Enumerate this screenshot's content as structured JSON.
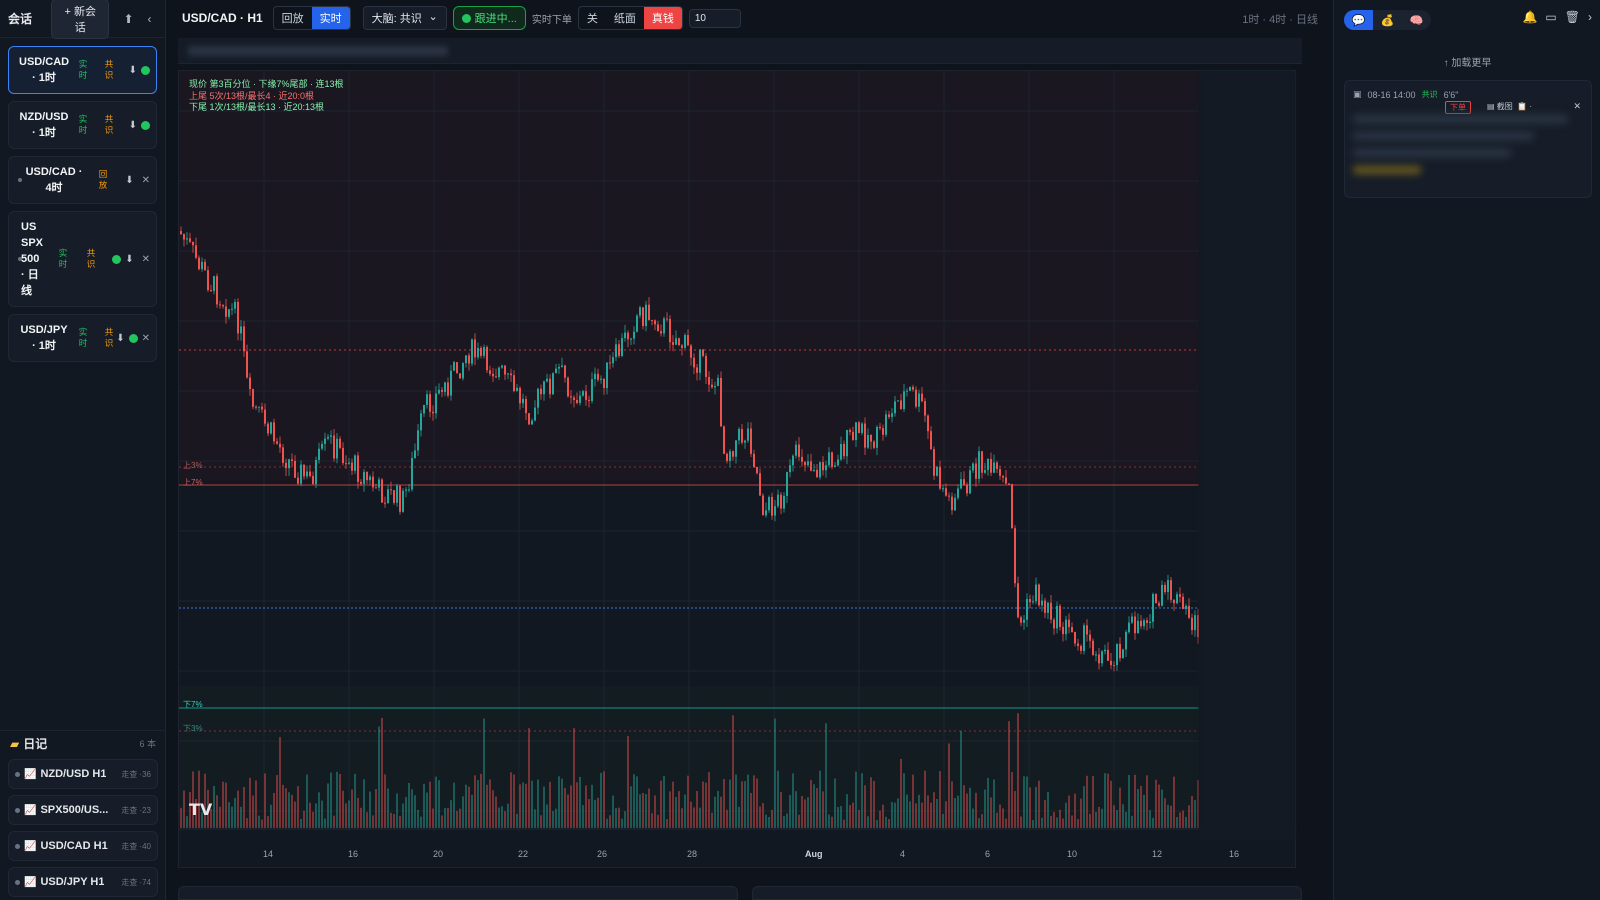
{
  "sidebar": {
    "title": "会话",
    "new_label": "+ 新会话",
    "sessions": [
      {
        "name1": "USD/CAD",
        "name2": "· 1时",
        "tag1": "实时",
        "tag2": "共识"
      },
      {
        "name1": "NZD/USD",
        "name2": "· 1时",
        "tag1": "实时",
        "tag2": "共识"
      },
      {
        "name1": "USD/CAD ·",
        "name2": "4时",
        "tag1": "回放",
        "tag2": ""
      },
      {
        "name1": "US SPX 500 · 日线",
        "name2": "",
        "tag1": "实时",
        "tag2": "共识"
      },
      {
        "name1": "USD/JPY",
        "name2": "· 1时",
        "tag1": "实时",
        "tag2": "共识"
      }
    ],
    "journal_title": "日记",
    "journal_count": "6 本",
    "journal_items": [
      {
        "name": "NZD/USD H1",
        "meta": "走查 ·36"
      },
      {
        "name": "SPX500/US...",
        "meta": "走查 ·23"
      },
      {
        "name": "USD/CAD H1",
        "meta": "走查 ·40"
      },
      {
        "name": "USD/JPY H1",
        "meta": "走查 ·74"
      }
    ]
  },
  "topbar": {
    "symbol": "USD/CAD · H1",
    "mode_replay": "回放",
    "mode_live": "实时",
    "brain_select": "大脑: 共识",
    "follow_label": "跟进中...",
    "order_label": "实时下单",
    "order_off": "关",
    "order_paper": "纸面",
    "order_real": "真钱",
    "qty": "10",
    "timeframes": "1时 · 4时 · 日线"
  },
  "chart": {
    "info_line1": "现价 第3百分位 · 下缘7%尾部 · 连13根",
    "info_line2": "上尾 5次/13根/最长4 · 近20:0根",
    "info_line3": "下尾 1次/13根/最长13 · 近20:13根",
    "band_up3": "上3%",
    "band_up7": "上7%",
    "band_dn7": "下7%",
    "band_dn3": "下3%",
    "logo": "TV",
    "x_labels": [
      "14",
      "16",
      "20",
      "22",
      "26",
      "28",
      "Aug",
      "4",
      "6",
      "10",
      "12",
      "16"
    ],
    "colors": {
      "up": "#26a69a",
      "down": "#ef5350",
      "upper_band": "#ef4444",
      "lower_band": "#14b8a6",
      "mid_line": "#3b82f6"
    }
  },
  "rpanel": {
    "tab_icons": [
      "chat-icon",
      "money-bag-icon",
      "brain-icon"
    ],
    "load_more": "↑ 加载更早",
    "msg_time": "08-16 14:00",
    "msg_tag": "共识",
    "msg_extra": "6'6\"",
    "msg_order": "下单",
    "msg_shot": "截图"
  }
}
